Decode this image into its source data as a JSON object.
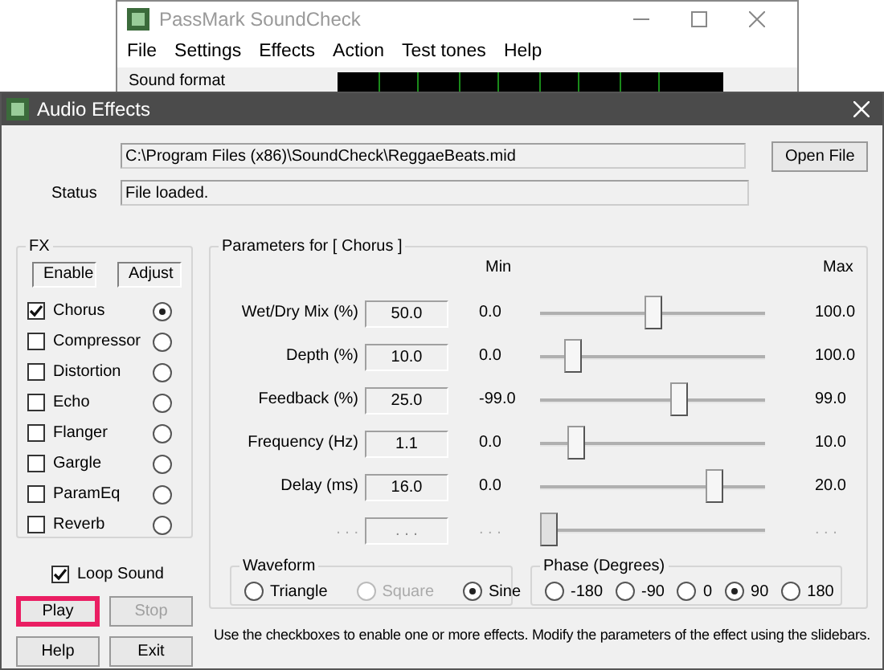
{
  "background_window": {
    "title": "PassMark SoundCheck",
    "menu": [
      "File",
      "Settings",
      "Effects",
      "Action",
      "Test tones",
      "Help"
    ],
    "group_label": "Sound format"
  },
  "dialog": {
    "title": "Audio Effects"
  },
  "file_path": "C:\\Program Files (x86)\\SoundCheck\\ReggaeBeats.mid",
  "open_button": "Open File",
  "status": {
    "label": "Status",
    "value": "File loaded."
  },
  "fx": {
    "title": "FX",
    "enable_header": "Enable",
    "adjust_header": "Adjust",
    "items": [
      {
        "name": "Chorus",
        "checked": true,
        "selected": true
      },
      {
        "name": "Compressor",
        "checked": false,
        "selected": false
      },
      {
        "name": "Distortion",
        "checked": false,
        "selected": false
      },
      {
        "name": "Echo",
        "checked": false,
        "selected": false
      },
      {
        "name": "Flanger",
        "checked": false,
        "selected": false
      },
      {
        "name": "Gargle",
        "checked": false,
        "selected": false
      },
      {
        "name": "ParamEq",
        "checked": false,
        "selected": false
      },
      {
        "name": "Reverb",
        "checked": false,
        "selected": false
      }
    ]
  },
  "parameters": {
    "title": "Parameters for [ Chorus ]",
    "min_header": "Min",
    "max_header": "Max",
    "rows": [
      {
        "label": "Wet/Dry Mix (%)",
        "value": "50.0",
        "min": "0.0",
        "max": "100.0",
        "level": 0.5,
        "disabled": false
      },
      {
        "label": "Depth (%)",
        "value": "10.0",
        "min": "0.0",
        "max": "100.0",
        "level": 0.12,
        "disabled": false
      },
      {
        "label": "Feedback (%)",
        "value": "25.0",
        "min": "-99.0",
        "max": "99.0",
        "level": 0.63,
        "disabled": false
      },
      {
        "label": "Frequency (Hz)",
        "value": "1.1",
        "min": "0.0",
        "max": "10.0",
        "level": 0.13,
        "disabled": false
      },
      {
        "label": "Delay (ms)",
        "value": "16.0",
        "min": "0.0",
        "max": "20.0",
        "level": 0.8,
        "disabled": false
      },
      {
        "label": ". . .",
        "value": ". . .",
        "min": ". . .",
        "max": ". . .",
        "level": 0,
        "disabled": true
      }
    ]
  },
  "waveform": {
    "title": "Waveform",
    "options": [
      {
        "label": "Triangle",
        "selected": false,
        "disabled": false
      },
      {
        "label": "Square",
        "selected": false,
        "disabled": true
      },
      {
        "label": "Sine",
        "selected": true,
        "disabled": false
      }
    ]
  },
  "phase": {
    "title": "Phase (Degrees)",
    "options": [
      {
        "label": "-180",
        "selected": false,
        "disabled": false
      },
      {
        "label": "-90",
        "selected": false,
        "disabled": false
      },
      {
        "label": "0",
        "selected": false,
        "disabled": false
      },
      {
        "label": "90",
        "selected": true,
        "disabled": false
      },
      {
        "label": "180",
        "selected": false,
        "disabled": false
      }
    ]
  },
  "loop_sound": {
    "label": "Loop Sound",
    "checked": true
  },
  "buttons": [
    {
      "label": "Play",
      "disabled": false,
      "highlighted": true
    },
    {
      "label": "Stop",
      "disabled": true,
      "highlighted": false
    },
    {
      "label": "Help",
      "disabled": false,
      "highlighted": false
    },
    {
      "label": "Exit",
      "disabled": false,
      "highlighted": false
    }
  ],
  "hint": "Use the checkboxes to enable one or more effects. Modify the parameters of the effect using the slidebars."
}
